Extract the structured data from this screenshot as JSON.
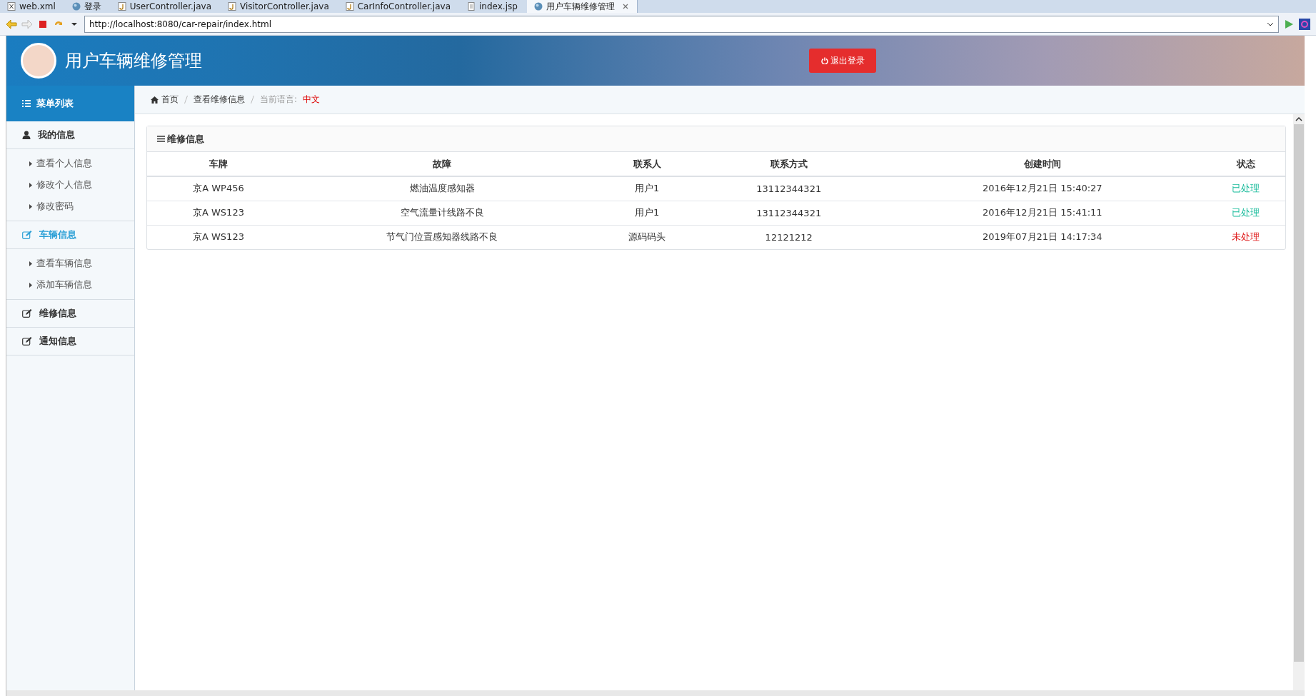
{
  "editor_tabs": [
    {
      "label": "web.xml",
      "kind": "xml",
      "selected": false
    },
    {
      "label": "登录",
      "kind": "globe",
      "selected": false
    },
    {
      "label": "UserController.java",
      "kind": "java",
      "selected": false
    },
    {
      "label": "VisitorController.java",
      "kind": "java",
      "selected": false
    },
    {
      "label": "CarInfoController.java",
      "kind": "java",
      "selected": false
    },
    {
      "label": "index.jsp",
      "kind": "file",
      "selected": false
    },
    {
      "label": "用户车辆维修管理",
      "kind": "globe",
      "selected": true,
      "closable": true
    }
  ],
  "address": {
    "value": "http://localhost:8080/car-repair/index.html"
  },
  "header": {
    "title": "用户车辆维修管理",
    "logout": "退出登录"
  },
  "sidebar": {
    "title": "菜单列表",
    "groups": [
      {
        "label": "我的信息",
        "kind": "user",
        "selected": false,
        "children": [
          "查看个人信息",
          "修改个人信息",
          "修改密码"
        ]
      },
      {
        "label": "车辆信息",
        "kind": "edit",
        "selected": true,
        "children": [
          "查看车辆信息",
          "添加车辆信息"
        ]
      },
      {
        "label": "维修信息",
        "kind": "edit",
        "selected": false
      },
      {
        "label": "通知信息",
        "kind": "edit",
        "selected": false
      }
    ]
  },
  "breadcrumb": {
    "home": "首页",
    "current": "查看维修信息",
    "language_label": "当前语言:",
    "language": "中文"
  },
  "panel": {
    "title": "维修信息",
    "columns": [
      "车牌",
      "故障",
      "联系人",
      "联系方式",
      "创建时间",
      "状态"
    ],
    "rows": [
      {
        "cells": [
          "京A WP456",
          "燃油温度感知器",
          "用户1",
          "13112344321",
          "2016年12月21日 15:40:27"
        ],
        "status": "已处理",
        "color": "#1abc9c"
      },
      {
        "cells": [
          "京A WS123",
          "空气流量计线路不良",
          "用户1",
          "13112344321",
          "2016年12月21日 15:41:11"
        ],
        "status": "已处理",
        "color": "#1abc9c"
      },
      {
        "cells": [
          "京A WS123",
          "节气门位置感知器线路不良",
          "源码码头",
          "12121212",
          "2019年07月21日 14:17:34"
        ],
        "status": "未处理",
        "color": "#e02020"
      }
    ]
  }
}
